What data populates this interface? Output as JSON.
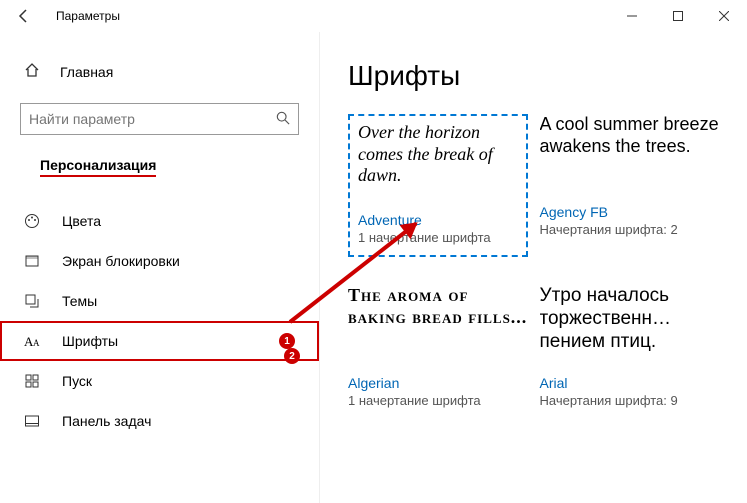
{
  "window": {
    "title": "Параметры"
  },
  "sidebar": {
    "home": "Главная",
    "search_placeholder": "Найти параметр",
    "section": "Персонализация",
    "items": [
      {
        "label": "Цвета"
      },
      {
        "label": "Экран блокировки"
      },
      {
        "label": "Темы"
      },
      {
        "label": "Шрифты"
      },
      {
        "label": "Пуск"
      },
      {
        "label": "Панель задач"
      }
    ]
  },
  "main": {
    "heading": "Шрифты",
    "fonts": [
      {
        "sample": "Over the horizon comes the break of dawn.",
        "name": "Adventure",
        "faces": "1 начертание шрифта"
      },
      {
        "sample": "A cool summer breeze awakens the trees.",
        "name": "Agency FB",
        "faces": "Начертания шрифта: 2"
      },
      {
        "sample": "The aroma of baking bread fills...",
        "name": "Algerian",
        "faces": "1 начертание шрифта"
      },
      {
        "sample": "Утро началось торжественн… пением птиц.",
        "name": "Arial",
        "faces": "Начертания шрифта: 9"
      }
    ]
  },
  "annotations": {
    "badge1": "1",
    "badge2": "2"
  }
}
